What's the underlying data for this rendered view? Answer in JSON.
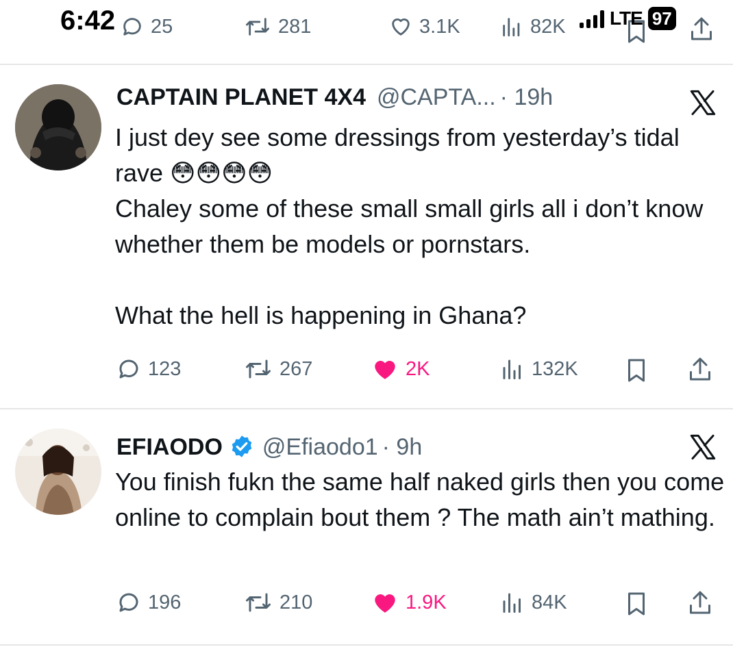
{
  "status_bar": {
    "time": "6:42",
    "network": "LTE",
    "battery": "97"
  },
  "prev_tweet_actions": {
    "replies": "25",
    "reposts": "281",
    "likes": "3.1K",
    "views": "82K"
  },
  "tweets": [
    {
      "name": "CAPTAIN PLANET 4X4",
      "handle": "@CAPTA...",
      "time": "· 19h",
      "verified": false,
      "text": "I just dey see some dressings from yesterday’s tidal rave 😳😳😳😳\nChaley some of these small small girls all i don’t know whether them be models or pornstars.\n\nWhat the hell is happening in Ghana?",
      "replies": "123",
      "reposts": "267",
      "likes": "2K",
      "views": "132K",
      "liked": true
    },
    {
      "name": "EFIAODO",
      "handle": "@Efiaodo1",
      "time": "· 9h",
      "verified": true,
      "text": "You finish fukn the same half naked girls then you come online to complain bout them ? The math ain’t mathing.",
      "replies": "196",
      "reposts": "210",
      "likes": "1.9K",
      "views": "84K",
      "liked": true
    }
  ],
  "icons": {
    "reply": "reply-icon",
    "repost": "repost-icon",
    "like": "heart-icon",
    "views": "views-icon",
    "bookmark": "bookmark-icon",
    "share": "share-icon",
    "menu": "x-logo-icon"
  },
  "colors": {
    "like_active": "#f91880",
    "secondary_text": "#536471",
    "primary_text": "#0f1419",
    "verified_blue": "#1d9bf0"
  }
}
